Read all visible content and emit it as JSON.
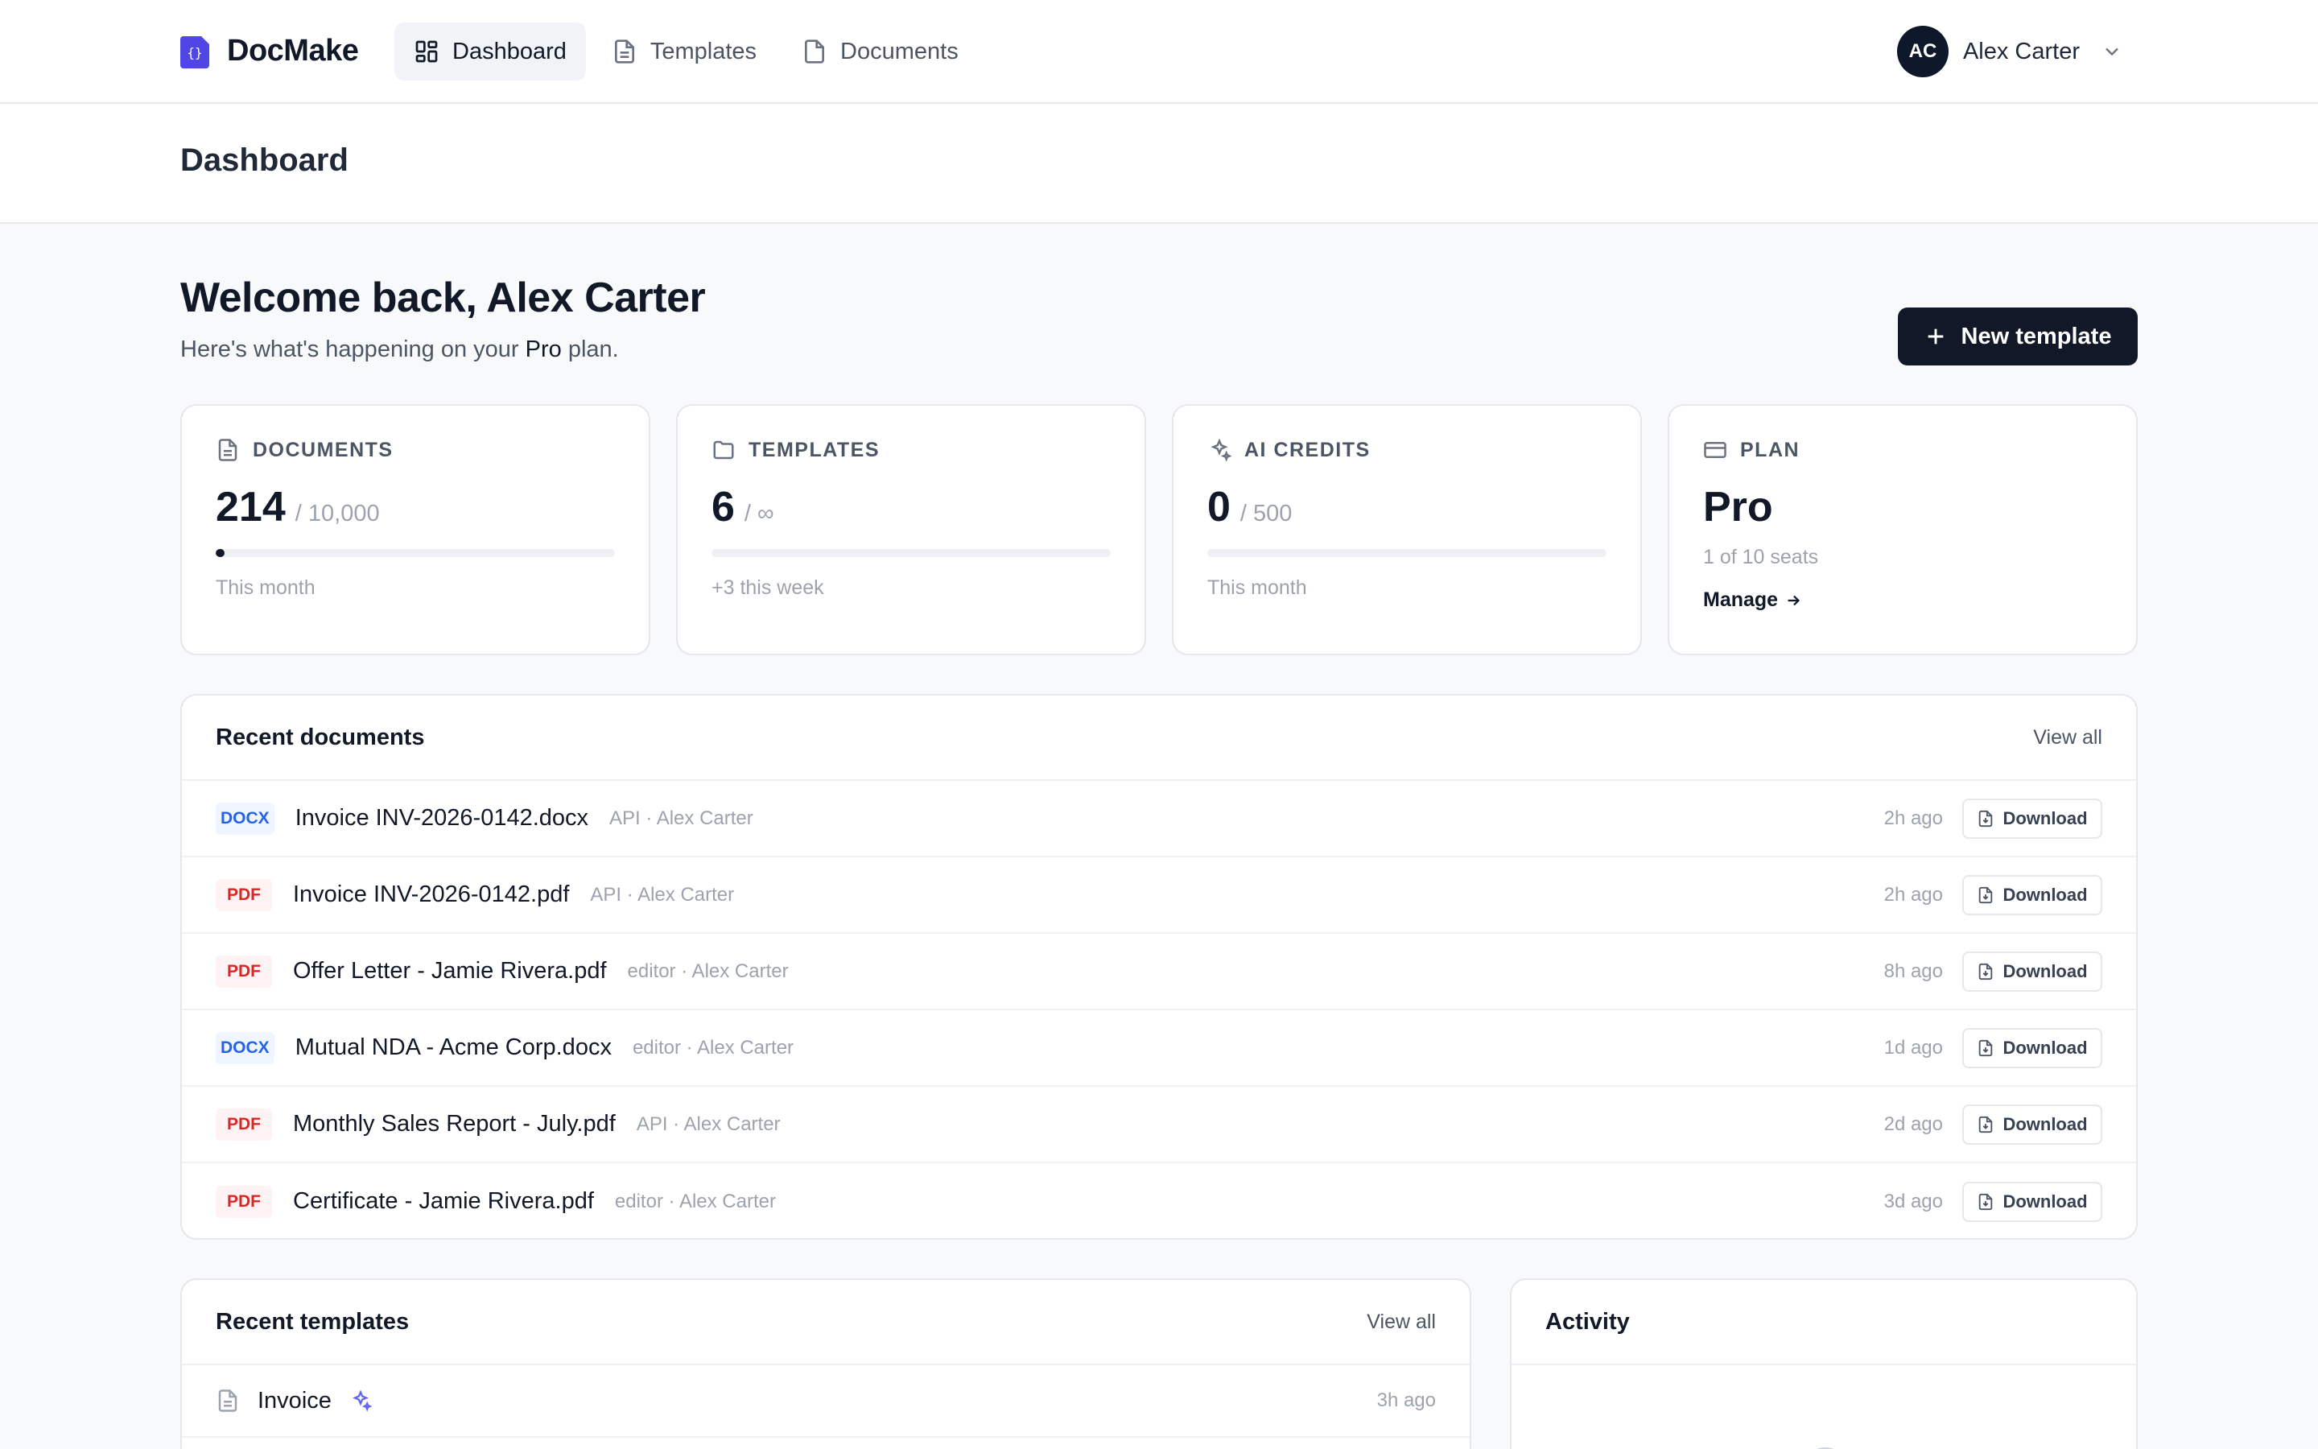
{
  "brand": {
    "name": "DocMake",
    "accent": "#4f46e5"
  },
  "nav": {
    "items": [
      {
        "label": "Dashboard",
        "icon": "dashboard-grid-icon",
        "active": true
      },
      {
        "label": "Templates",
        "icon": "file-text-icon",
        "active": false
      },
      {
        "label": "Documents",
        "icon": "file-icon",
        "active": false
      }
    ]
  },
  "user": {
    "initials": "AC",
    "name": "Alex Carter"
  },
  "page": {
    "title": "Dashboard"
  },
  "welcome": {
    "heading": "Welcome back, Alex Carter",
    "sub_prefix": "Here's what's happening on your ",
    "plan_word": "Pro",
    "sub_suffix": " plan."
  },
  "actions": {
    "new_template": "New template"
  },
  "stats": {
    "documents": {
      "label": "DOCUMENTS",
      "value": "214",
      "limit": "/ 10,000",
      "sub": "This month",
      "progress": 0.0214
    },
    "templates": {
      "label": "TEMPLATES",
      "value": "6",
      "limit": "/ ∞",
      "sub": "+3 this week",
      "progress": 0
    },
    "ai_credits": {
      "label": "AI CREDITS",
      "value": "0",
      "limit": "/ 500",
      "sub": "This month",
      "progress": 0
    },
    "plan": {
      "label": "PLAN",
      "value": "Pro",
      "seats": "1 of 10 seats",
      "manage": "Manage"
    }
  },
  "recent_documents": {
    "title": "Recent documents",
    "view_all": "View all",
    "download_label": "Download",
    "rows": [
      {
        "type": "DOCX",
        "name": "Invoice INV-2026-0142.docx",
        "meta": "API · Alex Carter",
        "time": "2h ago"
      },
      {
        "type": "PDF",
        "name": "Invoice INV-2026-0142.pdf",
        "meta": "API · Alex Carter",
        "time": "2h ago"
      },
      {
        "type": "PDF",
        "name": "Offer Letter - Jamie Rivera.pdf",
        "meta": "editor · Alex Carter",
        "time": "8h ago"
      },
      {
        "type": "DOCX",
        "name": "Mutual NDA - Acme Corp.docx",
        "meta": "editor · Alex Carter",
        "time": "1d ago"
      },
      {
        "type": "PDF",
        "name": "Monthly Sales Report - July.pdf",
        "meta": "API · Alex Carter",
        "time": "2d ago"
      },
      {
        "type": "PDF",
        "name": "Certificate - Jamie Rivera.pdf",
        "meta": "editor · Alex Carter",
        "time": "3d ago"
      }
    ]
  },
  "recent_templates": {
    "title": "Recent templates",
    "view_all": "View all",
    "rows": [
      {
        "name": "Invoice",
        "time": "3h ago",
        "ai": true
      }
    ]
  },
  "activity": {
    "title": "Activity"
  },
  "colors": {
    "primary": "#111827",
    "docx": "#2563eb",
    "pdf": "#dc2626"
  }
}
